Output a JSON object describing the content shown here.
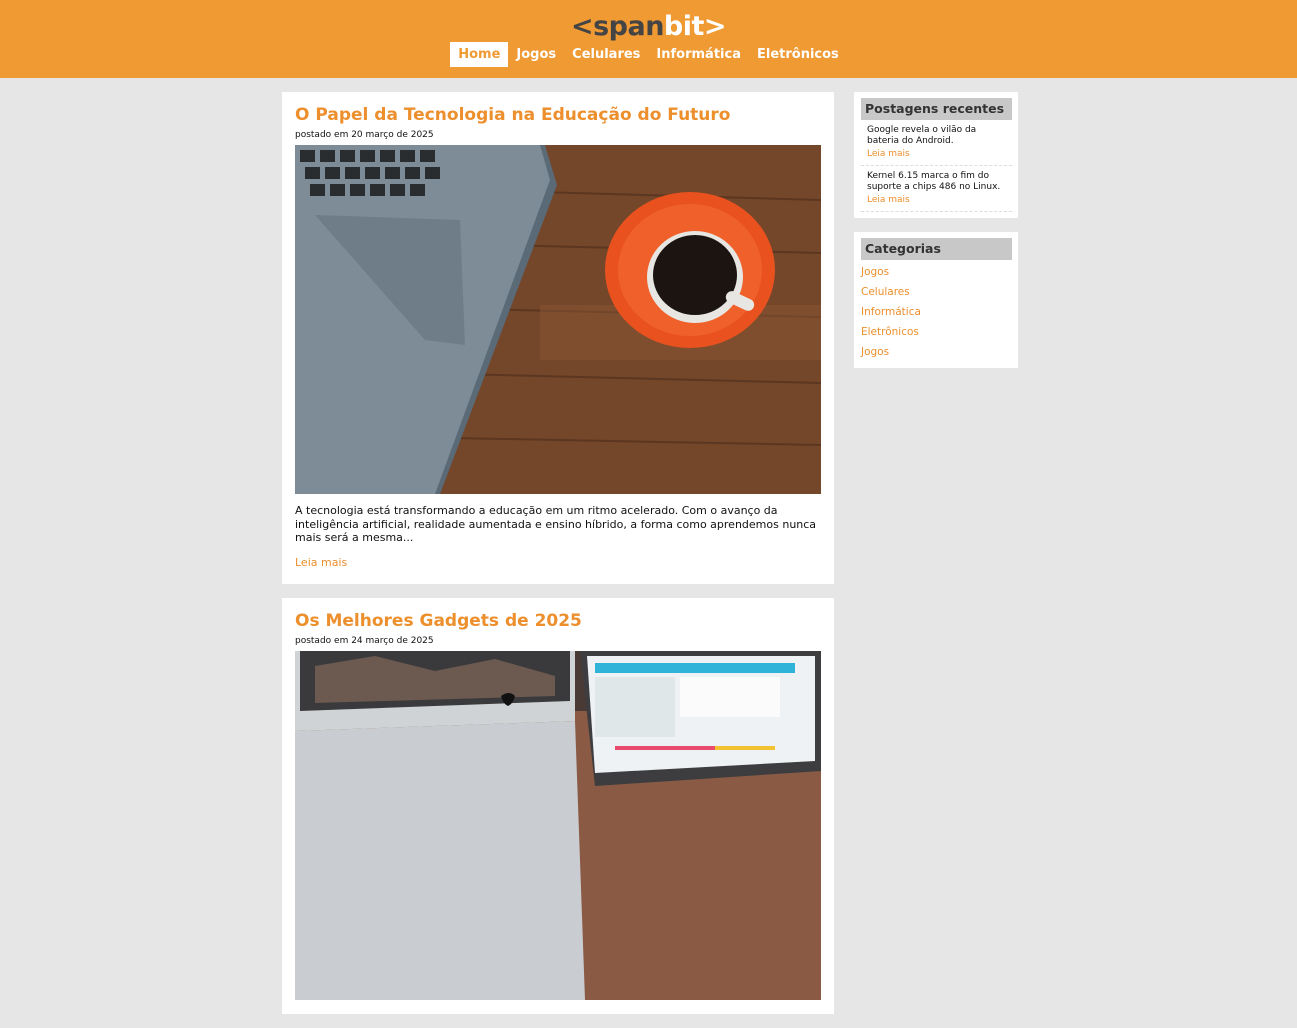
{
  "site": {
    "logo_open": "<span",
    "logo_bit": "bit",
    "logo_close": ">"
  },
  "nav": [
    {
      "label": "Home",
      "active": true
    },
    {
      "label": "Jogos"
    },
    {
      "label": "Celulares"
    },
    {
      "label": "Informática"
    },
    {
      "label": "Eletrônicos"
    }
  ],
  "posts": [
    {
      "title": "O Papel da Tecnologia na Educação do Futuro",
      "date": "postado em 20 março de 2025",
      "excerpt": "A tecnologia está transformando a educação em um ritmo acelerado. Com o avanço da inteligência artificial, realidade aumentada e ensino híbrido, a forma como aprendemos nunca mais será a mesma...",
      "more": "Leia mais"
    },
    {
      "title": "Os Melhores Gadgets de 2025",
      "date": "postado em 24 março de 2025"
    }
  ],
  "sidebar": {
    "recent_title": "Postagens recentes",
    "recent": [
      {
        "title": "Google revela o vilão da bateria do Android.",
        "more": "Leia mais"
      },
      {
        "title": "Kernel 6.15 marca o fim do suporte a chips 486 no Linux.",
        "more": "Leia mais"
      }
    ],
    "categories_title": "Categorias",
    "categories": [
      "Jogos",
      "Celulares",
      "Informática",
      "Eletrônicos",
      "Jogos"
    ]
  },
  "colors": {
    "accent": "#f09a34",
    "background": "#e6e6e6"
  }
}
